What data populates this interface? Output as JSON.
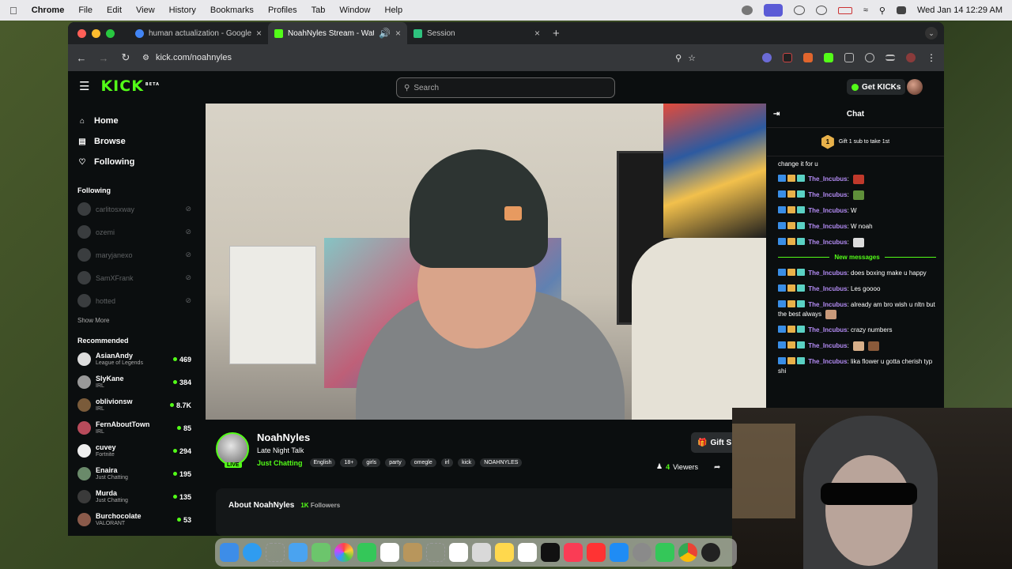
{
  "menubar": {
    "app": "Chrome",
    "items": [
      "File",
      "Edit",
      "View",
      "History",
      "Bookmarks",
      "Profiles",
      "Tab",
      "Window",
      "Help"
    ],
    "clock": "Wed Jan 14  12:29 AM"
  },
  "browser": {
    "tabs": [
      {
        "title": "human actualization - Google",
        "favicon_color": "#4285f4"
      },
      {
        "title": "NoahNyles Stream - Watc",
        "favicon_color": "#53fc18"
      },
      {
        "title": "Session",
        "favicon_color": "#2ec27e"
      }
    ],
    "url": "kick.com/noahnyles"
  },
  "kick": {
    "logo": "KICK",
    "logo_badge": "BETA",
    "search_placeholder": "Search",
    "get_kicks": "Get KICKs",
    "nav": [
      {
        "label": "Home",
        "icon": "home-icon"
      },
      {
        "label": "Browse",
        "icon": "browse-icon"
      },
      {
        "label": "Following",
        "icon": "heart-icon"
      }
    ],
    "following_heading": "Following",
    "following": [
      "carlitosxway",
      "ozemi",
      "maryjanexo",
      "SamXFrank",
      "hotted"
    ],
    "show_more": "Show More",
    "recommended_heading": "Recommended",
    "recommended": [
      {
        "name": "AsianAndy",
        "category": "League of Legends",
        "viewers": "469"
      },
      {
        "name": "SlyKane",
        "category": "IRL",
        "viewers": "384"
      },
      {
        "name": "oblivionsw",
        "category": "IRL",
        "viewers": "8.7K"
      },
      {
        "name": "FernAboutTown",
        "category": "IRL",
        "viewers": "85"
      },
      {
        "name": "cuvey",
        "category": "Fortnite",
        "viewers": "294"
      },
      {
        "name": "Enaira",
        "category": "Just Chatting",
        "viewers": "195"
      },
      {
        "name": "Murda",
        "category": "Just Chatting",
        "viewers": "135"
      },
      {
        "name": "Burchocolate",
        "category": "VALORANT",
        "viewers": "53"
      }
    ]
  },
  "stream": {
    "name": "NoahNyles",
    "title": "Late Night Talk",
    "live_label": "LIVE",
    "category": "Just Chatting",
    "tags": [
      "English",
      "18+",
      "girls",
      "party",
      "omegle",
      "irl",
      "kick",
      "NOAHNYLES"
    ],
    "viewers_count": "4",
    "viewers_label": "Viewers",
    "gift_button": "Gift S",
    "about_title": "About NoahNyles",
    "followers_count": "1K",
    "followers_label": "Followers"
  },
  "chat": {
    "title": "Chat",
    "gift_prompt": "Gift 1 sub to take 1st",
    "gift_rank": "1",
    "new_messages_label": "New messages",
    "messages_before": [
      {
        "user": "",
        "text": "change it for u",
        "emote": ""
      },
      {
        "user": "The_Incubus",
        "text": ":",
        "emote": "#c0392b"
      },
      {
        "user": "The_Incubus",
        "text": ":",
        "emote": "#5f8f3a"
      },
      {
        "user": "The_Incubus",
        "text": ": W",
        "emote": ""
      },
      {
        "user": "The_Incubus",
        "text": ": W noah",
        "emote": ""
      },
      {
        "user": "The_Incubus",
        "text": ":",
        "emote": "#dcdcdc"
      }
    ],
    "messages_after": [
      {
        "user": "The_Incubus",
        "text": ": does boxing make u happy"
      },
      {
        "user": "The_Incubus",
        "text": ": Les goooo"
      },
      {
        "user": "The_Incubus",
        "text": ": already am bro wish u nltn but the best always"
      },
      {
        "user": "The_Incubus",
        "text": ": crazy numbers"
      },
      {
        "user": "The_Incubus",
        "text": ":"
      },
      {
        "user": "The_Incubus",
        "text": ": lika flower u gotta cherish typ shi"
      }
    ]
  },
  "colors": {
    "kick_green": "#53fc18",
    "username_purple": "#b48cf5",
    "page_bg": "#0b0e0f"
  }
}
